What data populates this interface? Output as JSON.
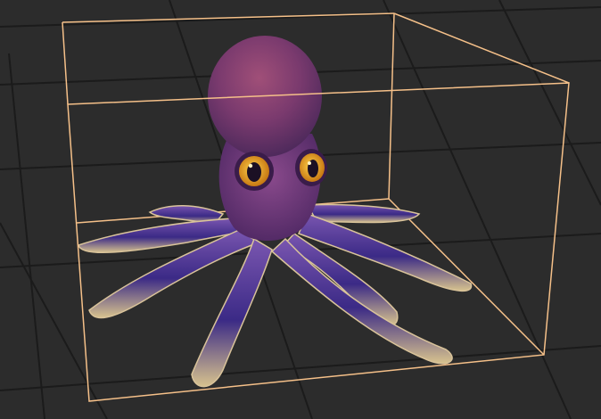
{
  "viewport": {
    "background_color": "#2c2c2c",
    "grid_line_color": "#1a1a1a",
    "selection_bbox_color": "#f5c089",
    "selected": true
  },
  "model": {
    "subject": "octopus",
    "body_color": "#6a3a82",
    "mantle_color": "#8a3f6a",
    "underside_color": "#dcc49a",
    "eye_iris_color": "#e3a21a",
    "eye_pupil_color": "#1b1024"
  }
}
